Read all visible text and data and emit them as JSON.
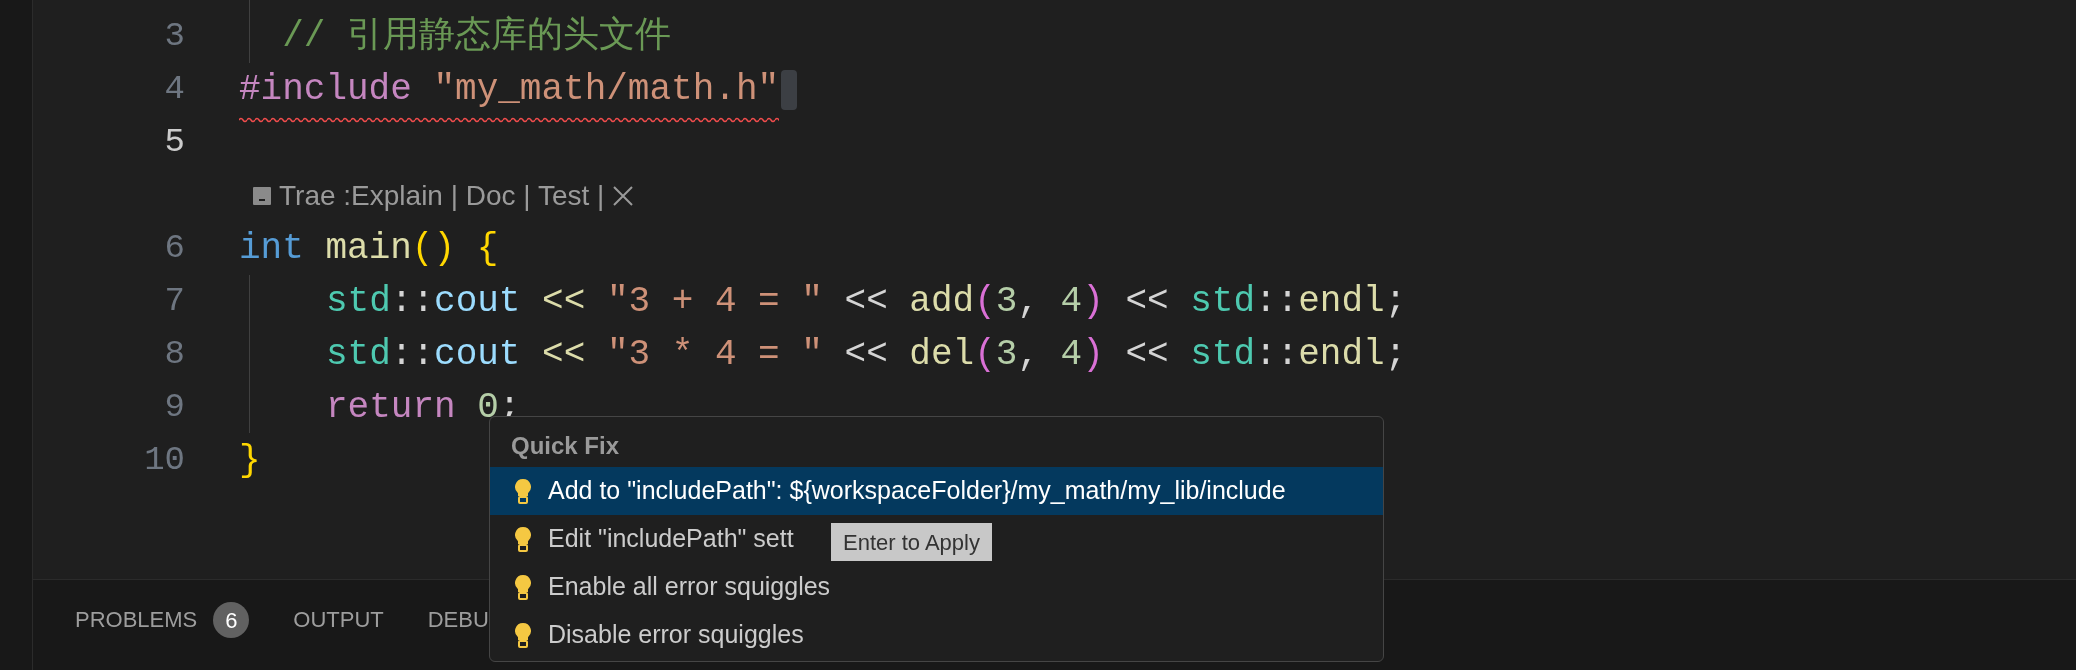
{
  "editor": {
    "lines": [
      {
        "number": "3",
        "current": false,
        "error": false,
        "cursor": false,
        "tokens": [
          {
            "text": "  // 引用静态库的头文件",
            "kind": "comment"
          }
        ]
      },
      {
        "number": "4",
        "current": false,
        "error": true,
        "cursor": true,
        "tokens": [
          {
            "text": "#include ",
            "kind": "directive"
          },
          {
            "text": "\"my_math/math.h\"",
            "kind": "string"
          }
        ]
      },
      {
        "number": "5",
        "current": true,
        "error": false,
        "cursor": false,
        "codelens": {
          "text": "Trae :Explain | Doc | Test |"
        }
      },
      {
        "number": "6",
        "current": false,
        "error": false,
        "cursor": false,
        "tokens": [
          {
            "text": "int ",
            "kind": "type"
          },
          {
            "text": "main",
            "kind": "function"
          },
          {
            "text": "() {",
            "kind": "bracket"
          }
        ],
        "children": [
          {
            "number": "7",
            "current": false,
            "error": false,
            "cursor": false,
            "tokens": [
              {
                "text": "std",
                "kind": "namespace"
              },
              {
                "text": "::",
                "kind": "plain"
              },
              {
                "text": "cout",
                "kind": "variable"
              },
              {
                "text": " << ",
                "kind": "operator"
              },
              {
                "text": "\"3 + 4 = \"",
                "kind": "string"
              },
              {
                "text": " << ",
                "kind": "plain"
              },
              {
                "text": "add",
                "kind": "function"
              },
              {
                "text": "(",
                "kind": "bracket2"
              },
              {
                "text": "3",
                "kind": "number"
              },
              {
                "text": ", ",
                "kind": "plain"
              },
              {
                "text": "4",
                "kind": "number"
              },
              {
                "text": ")",
                "kind": "bracket2"
              },
              {
                "text": " << ",
                "kind": "plain"
              },
              {
                "text": "std",
                "kind": "namespace"
              },
              {
                "text": "::",
                "kind": "plain"
              },
              {
                "text": "endl",
                "kind": "function"
              },
              {
                "text": ";",
                "kind": "plain"
              }
            ]
          },
          {
            "number": "8",
            "current": false,
            "error": false,
            "cursor": false,
            "tokens": [
              {
                "text": "std",
                "kind": "namespace"
              },
              {
                "text": "::",
                "kind": "plain"
              },
              {
                "text": "cout",
                "kind": "variable"
              },
              {
                "text": " << ",
                "kind": "operator"
              },
              {
                "text": "\"3 * 4 = \"",
                "kind": "string"
              },
              {
                "text": " << ",
                "kind": "plain"
              },
              {
                "text": "del",
                "kind": "function"
              },
              {
                "text": "(",
                "kind": "bracket2"
              },
              {
                "text": "3",
                "kind": "number"
              },
              {
                "text": ", ",
                "kind": "plain"
              },
              {
                "text": "4",
                "kind": "number"
              },
              {
                "text": ")",
                "kind": "bracket2"
              },
              {
                "text": " << ",
                "kind": "plain"
              },
              {
                "text": "std",
                "kind": "namespace"
              },
              {
                "text": "::",
                "kind": "plain"
              },
              {
                "text": "endl",
                "kind": "function"
              },
              {
                "text": ";",
                "kind": "plain"
              }
            ]
          },
          {
            "number": "9",
            "current": false,
            "error": false,
            "cursor": false,
            "tokens": [
              {
                "text": "return ",
                "kind": "control"
              },
              {
                "text": "0",
                "kind": "number"
              },
              {
                "text": ";",
                "kind": "plain"
              }
            ]
          }
        ]
      },
      {
        "number": "10",
        "current": false,
        "error": false,
        "cursor": false,
        "tokens": [
          {
            "text": "}",
            "kind": "bracket"
          }
        ]
      }
    ]
  },
  "quick_fix": {
    "title": "Quick Fix",
    "items": [
      {
        "label": "Add to \"includePath\": ${workspaceFolder}/my_math/my_lib/include",
        "selected": true
      },
      {
        "label": "Edit \"includePath\" sett",
        "selected": false
      },
      {
        "label": "Enable all error squiggles",
        "selected": false
      },
      {
        "label": "Disable error squiggles",
        "selected": false
      }
    ],
    "tooltip": "Enter to Apply"
  },
  "panel": {
    "tabs": [
      {
        "label": "PROBLEMS",
        "badge": "6"
      },
      {
        "label": "OUTPUT"
      },
      {
        "label": "DEBU"
      }
    ]
  }
}
